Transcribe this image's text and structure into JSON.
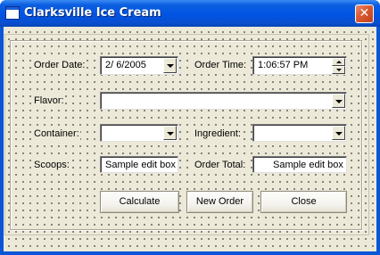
{
  "window": {
    "title": "Clarksville Ice Cream",
    "close_glyph": "✕"
  },
  "form": {
    "order_date": {
      "label": "Order Date:",
      "value": "2/  6/2005"
    },
    "order_time": {
      "label": "Order Time:",
      "value": "1:06:57 PM"
    },
    "flavor": {
      "label": "Flavor:",
      "value": ""
    },
    "container": {
      "label": "Container:",
      "value": ""
    },
    "ingredient": {
      "label": "Ingredient:",
      "value": ""
    },
    "scoops": {
      "label": "Scoops:",
      "value": "Sample edit box"
    },
    "order_total": {
      "label": "Order Total:",
      "value": "Sample edit box"
    }
  },
  "buttons": {
    "calculate": "Calculate",
    "new_order": "New Order",
    "close": "Close"
  },
  "icons": {
    "app": "window-icon",
    "close": "close-icon",
    "dropdown": "chevron-down-icon",
    "spin_up": "spin-up-icon",
    "spin_down": "spin-down-icon"
  },
  "colors": {
    "titlebar": "#0054e3",
    "client_bg": "#ece9d8",
    "close_button": "#d9582f"
  }
}
